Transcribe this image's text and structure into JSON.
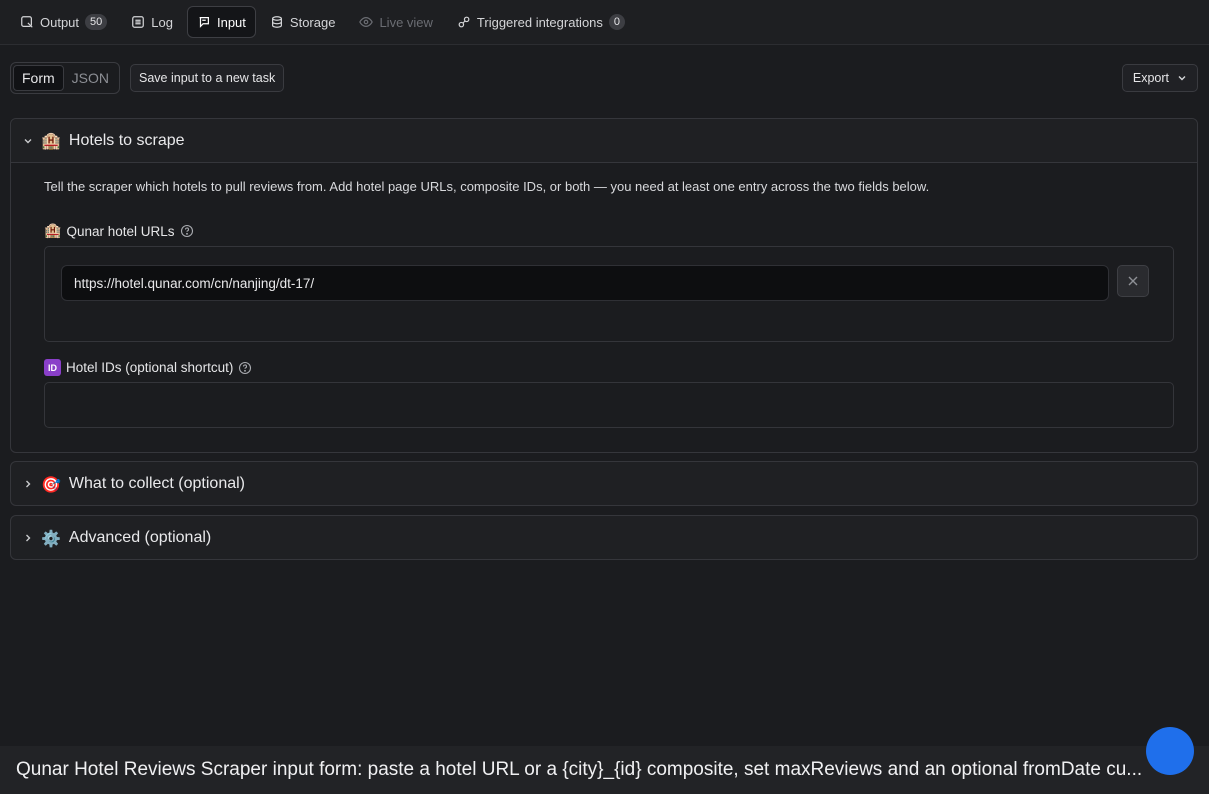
{
  "tabs": [
    {
      "label": "Output",
      "badge": "50",
      "icon": "output-icon"
    },
    {
      "label": "Log",
      "icon": "log-icon"
    },
    {
      "label": "Input",
      "icon": "input-icon",
      "active": true
    },
    {
      "label": "Storage",
      "icon": "storage-icon"
    },
    {
      "label": "Live view",
      "icon": "live-view-icon",
      "disabled": true
    },
    {
      "label": "Triggered integrations",
      "badge": "0",
      "icon": "integrations-icon"
    }
  ],
  "toolbar": {
    "form_label": "Form",
    "json_label": "JSON",
    "save_label": "Save input to a new task",
    "export_label": "Export"
  },
  "sections": {
    "hotels": {
      "emoji": "🏨",
      "title": "Hotels to scrape",
      "description": "Tell the scraper which hotels to pull reviews from. Add hotel page URLs, composite IDs, or both — you need at least one entry across the two fields below.",
      "urls_label": "Qunar hotel URLs",
      "urls_emoji": "🏨",
      "url_value": "https://hotel.qunar.com/cn/nanjing/dt-17/",
      "ids_badge": "ID",
      "ids_label": "Hotel IDs (optional shortcut)",
      "ids_value": ""
    },
    "collect": {
      "emoji": "🎯",
      "title": "What to collect (optional)"
    },
    "advanced": {
      "emoji": "⚙️",
      "title": "Advanced (optional)"
    }
  },
  "caption": "Qunar Hotel Reviews Scraper input form: paste a hotel URL or a {city}_{id} composite, set maxReviews and an optional fromDate cu...",
  "colors": {
    "background": "#1b1c1f",
    "accent": "#1f6feb",
    "id_badge": "#8a3fc9"
  }
}
